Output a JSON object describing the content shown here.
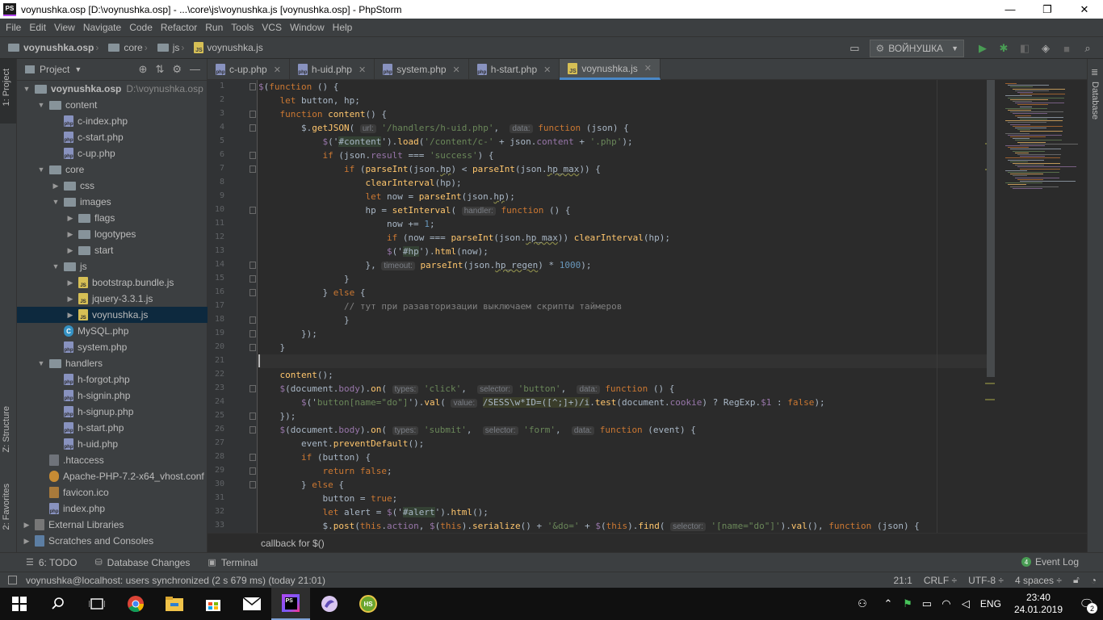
{
  "window": {
    "title": "voynushka.osp [D:\\voynushka.osp] - ...\\core\\js\\voynushka.js [voynushka.osp] - PhpStorm",
    "app_icon": "PS",
    "controls": {
      "minimize": "—",
      "maximize": "❐",
      "close": "✕"
    }
  },
  "menu": [
    "File",
    "Edit",
    "View",
    "Navigate",
    "Code",
    "Refactor",
    "Run",
    "Tools",
    "VCS",
    "Window",
    "Help"
  ],
  "navbar": {
    "crumbs": [
      "voynushka.osp",
      "core",
      "js",
      "voynushka.js"
    ],
    "run_config": "ВОЙНУШКА"
  },
  "left_strip": {
    "project": "1: Project",
    "structure": "Z: Structure",
    "favorites": "2: Favorites"
  },
  "right_strip": {
    "database": "Database"
  },
  "project_panel": {
    "title": "Project",
    "tree": [
      {
        "label": "voynushka.osp",
        "sub": "D:\\voynushka.osp",
        "depth": 0,
        "kind": "dir",
        "open": true,
        "bold": true
      },
      {
        "label": "content",
        "depth": 1,
        "kind": "dir",
        "open": true
      },
      {
        "label": "c-index.php",
        "depth": 2,
        "kind": "php"
      },
      {
        "label": "c-start.php",
        "depth": 2,
        "kind": "php"
      },
      {
        "label": "c-up.php",
        "depth": 2,
        "kind": "php"
      },
      {
        "label": "core",
        "depth": 1,
        "kind": "dir",
        "open": true
      },
      {
        "label": "css",
        "depth": 2,
        "kind": "dir",
        "open": false
      },
      {
        "label": "images",
        "depth": 2,
        "kind": "dir",
        "open": true
      },
      {
        "label": "flags",
        "depth": 3,
        "kind": "dir",
        "open": false
      },
      {
        "label": "logotypes",
        "depth": 3,
        "kind": "dir",
        "open": false
      },
      {
        "label": "start",
        "depth": 3,
        "kind": "dir",
        "open": false
      },
      {
        "label": "js",
        "depth": 2,
        "kind": "dir",
        "open": true
      },
      {
        "label": "bootstrap.bundle.js",
        "depth": 3,
        "kind": "js",
        "arrow": true
      },
      {
        "label": "jquery-3.3.1.js",
        "depth": 3,
        "kind": "js",
        "arrow": true
      },
      {
        "label": "voynushka.js",
        "depth": 3,
        "kind": "js",
        "arrow": true,
        "selected": true
      },
      {
        "label": "MySQL.php",
        "depth": 2,
        "kind": "sql"
      },
      {
        "label": "system.php",
        "depth": 2,
        "kind": "php"
      },
      {
        "label": "handlers",
        "depth": 1,
        "kind": "dir",
        "open": true
      },
      {
        "label": "h-forgot.php",
        "depth": 2,
        "kind": "php"
      },
      {
        "label": "h-signin.php",
        "depth": 2,
        "kind": "php"
      },
      {
        "label": "h-signup.php",
        "depth": 2,
        "kind": "php"
      },
      {
        "label": "h-start.php",
        "depth": 2,
        "kind": "php"
      },
      {
        "label": "h-uid.php",
        "depth": 2,
        "kind": "php"
      },
      {
        "label": ".htaccess",
        "depth": 1,
        "kind": "ht"
      },
      {
        "label": "Apache-PHP-7.2-x64_vhost.conf",
        "depth": 1,
        "kind": "conf"
      },
      {
        "label": "favicon.ico",
        "depth": 1,
        "kind": "ico"
      },
      {
        "label": "index.php",
        "depth": 1,
        "kind": "php"
      },
      {
        "label": "External Libraries",
        "depth": 0,
        "kind": "lib",
        "open": false
      },
      {
        "label": "Scratches and Consoles",
        "depth": 0,
        "kind": "scr",
        "open": false
      }
    ]
  },
  "tabs": [
    {
      "label": "c-up.php",
      "kind": "php",
      "active": false
    },
    {
      "label": "h-uid.php",
      "kind": "php",
      "active": false
    },
    {
      "label": "system.php",
      "kind": "php",
      "active": false
    },
    {
      "label": "h-start.php",
      "kind": "php",
      "active": false
    },
    {
      "label": "voynushka.js",
      "kind": "js",
      "active": true
    }
  ],
  "editor": {
    "line_numbers": [
      "1",
      "2",
      "3",
      "4",
      "5",
      "6",
      "7",
      "8",
      "9",
      "10",
      "11",
      "12",
      "13",
      "14",
      "15",
      "16",
      "17",
      "18",
      "19",
      "20",
      "21",
      "22",
      "23",
      "24",
      "25",
      "26",
      "27",
      "28",
      "29",
      "30",
      "31",
      "32",
      "33"
    ],
    "current_line": 21,
    "lines": [
      [
        [
          "$",
          "p"
        ],
        [
          "(",
          ""
        ],
        [
          "function",
          "k"
        ],
        [
          " () {",
          ""
        ]
      ],
      [
        [
          "    ",
          ""
        ],
        [
          "let",
          "k"
        ],
        [
          " button, hp;",
          ""
        ]
      ],
      [
        [
          "    ",
          ""
        ],
        [
          "function",
          "k"
        ],
        [
          " ",
          ""
        ],
        [
          "content",
          "f"
        ],
        [
          "() {",
          ""
        ]
      ],
      [
        [
          "        $.",
          ""
        ],
        [
          "getJSON",
          "f"
        ],
        [
          "( ",
          ""
        ],
        [
          "url:",
          "hint"
        ],
        [
          " ",
          ""
        ],
        [
          "'/handlers/h-uid.php'",
          "s"
        ],
        [
          ",  ",
          ""
        ],
        [
          "data:",
          "hint"
        ],
        [
          " ",
          ""
        ],
        [
          "function",
          "k"
        ],
        [
          " (json) {",
          ""
        ]
      ],
      [
        [
          "            ",
          ""
        ],
        [
          "$",
          "p"
        ],
        [
          "('",
          ""
        ],
        [
          "#content",
          "sel"
        ],
        [
          "').",
          ""
        ],
        [
          "load",
          "f"
        ],
        [
          "(",
          ""
        ],
        [
          "'/content/c-'",
          "s"
        ],
        [
          " + json.",
          ""
        ],
        [
          "content",
          "p"
        ],
        [
          " + ",
          ""
        ],
        [
          "'.php'",
          "s"
        ],
        [
          ");",
          ""
        ]
      ],
      [
        [
          "            ",
          ""
        ],
        [
          "if",
          "k"
        ],
        [
          " (json.",
          ""
        ],
        [
          "result",
          "p"
        ],
        [
          " === ",
          ""
        ],
        [
          "'success'",
          "s"
        ],
        [
          ") {",
          ""
        ]
      ],
      [
        [
          "                ",
          ""
        ],
        [
          "if",
          "k"
        ],
        [
          " (",
          ""
        ],
        [
          "parseInt",
          "f"
        ],
        [
          "(json.",
          ""
        ],
        [
          "hp",
          "ul"
        ],
        [
          ") < ",
          ""
        ],
        [
          "parseInt",
          "f"
        ],
        [
          "(json.",
          ""
        ],
        [
          "hp_max",
          "ul"
        ],
        [
          ")) {",
          ""
        ]
      ],
      [
        [
          "                    ",
          ""
        ],
        [
          "clearInterval",
          "f"
        ],
        [
          "(hp);",
          ""
        ]
      ],
      [
        [
          "                    ",
          ""
        ],
        [
          "let",
          "k"
        ],
        [
          " now = ",
          ""
        ],
        [
          "parseInt",
          "f"
        ],
        [
          "(json.",
          ""
        ],
        [
          "hp",
          "ul"
        ],
        [
          ");",
          ""
        ]
      ],
      [
        [
          "                    hp = ",
          ""
        ],
        [
          "setInterval",
          "f"
        ],
        [
          "( ",
          ""
        ],
        [
          "handler:",
          "hint"
        ],
        [
          " ",
          ""
        ],
        [
          "function",
          "k"
        ],
        [
          " () {",
          ""
        ]
      ],
      [
        [
          "                        now += ",
          ""
        ],
        [
          "1",
          "n"
        ],
        [
          ";",
          ""
        ]
      ],
      [
        [
          "                        ",
          ""
        ],
        [
          "if",
          "k"
        ],
        [
          " (now === ",
          ""
        ],
        [
          "parseInt",
          "f"
        ],
        [
          "(json.",
          ""
        ],
        [
          "hp_max",
          "ul"
        ],
        [
          ")) ",
          ""
        ],
        [
          "clearInterval",
          "f"
        ],
        [
          "(hp);",
          ""
        ]
      ],
      [
        [
          "                        ",
          ""
        ],
        [
          "$",
          "p"
        ],
        [
          "('",
          ""
        ],
        [
          "#hp",
          "sel"
        ],
        [
          "').",
          ""
        ],
        [
          "html",
          "f"
        ],
        [
          "(now);",
          ""
        ]
      ],
      [
        [
          "                    }, ",
          ""
        ],
        [
          "timeout:",
          "hint"
        ],
        [
          " ",
          ""
        ],
        [
          "parseInt",
          "f"
        ],
        [
          "(json.",
          ""
        ],
        [
          "hp_regen",
          "ul"
        ],
        [
          ") * ",
          ""
        ],
        [
          "1000",
          "n"
        ],
        [
          ");",
          ""
        ]
      ],
      [
        [
          "                }",
          ""
        ]
      ],
      [
        [
          "            } ",
          ""
        ],
        [
          "else",
          "k"
        ],
        [
          " {",
          ""
        ]
      ],
      [
        [
          "                ",
          ""
        ],
        [
          "// тут при разавторизации выключаем скрипты таймеров",
          "c"
        ]
      ],
      [
        [
          "                }",
          ""
        ]
      ],
      [
        [
          "        });",
          ""
        ]
      ],
      [
        [
          "    }",
          ""
        ]
      ],
      [
        [
          "",
          ""
        ]
      ],
      [
        [
          "    ",
          ""
        ],
        [
          "content",
          "f"
        ],
        [
          "();",
          ""
        ]
      ],
      [
        [
          "    ",
          ""
        ],
        [
          "$",
          "p"
        ],
        [
          "(document.",
          ""
        ],
        [
          "body",
          "p"
        ],
        [
          ").",
          ""
        ],
        [
          "on",
          "f"
        ],
        [
          "( ",
          ""
        ],
        [
          "types:",
          "hint"
        ],
        [
          " ",
          ""
        ],
        [
          "'click'",
          "s"
        ],
        [
          ",  ",
          ""
        ],
        [
          "selector:",
          "hint"
        ],
        [
          " ",
          ""
        ],
        [
          "'button'",
          "s"
        ],
        [
          ",  ",
          ""
        ],
        [
          "data:",
          "hint"
        ],
        [
          " ",
          ""
        ],
        [
          "function",
          "k"
        ],
        [
          " () {",
          ""
        ]
      ],
      [
        [
          "        ",
          ""
        ],
        [
          "$",
          "p"
        ],
        [
          "('",
          ""
        ],
        [
          "button[name=\"do\"]",
          "s"
        ],
        [
          "').",
          ""
        ],
        [
          "val",
          "f"
        ],
        [
          "( ",
          ""
        ],
        [
          "value:",
          "hint"
        ],
        [
          " ",
          ""
        ],
        [
          "/SESS\\w*ID=([^;]+)/i",
          "rx"
        ],
        [
          ".",
          ""
        ],
        [
          "test",
          "f"
        ],
        [
          "(document.",
          ""
        ],
        [
          "cookie",
          "p"
        ],
        [
          ") ? RegExp.",
          ""
        ],
        [
          "$1",
          "p"
        ],
        [
          " : ",
          ""
        ],
        [
          "false",
          "k"
        ],
        [
          ");",
          ""
        ]
      ],
      [
        [
          "    });",
          ""
        ]
      ],
      [
        [
          "    ",
          ""
        ],
        [
          "$",
          "p"
        ],
        [
          "(document.",
          ""
        ],
        [
          "body",
          "p"
        ],
        [
          ").",
          ""
        ],
        [
          "on",
          "f"
        ],
        [
          "( ",
          ""
        ],
        [
          "types:",
          "hint"
        ],
        [
          " ",
          ""
        ],
        [
          "'submit'",
          "s"
        ],
        [
          ",  ",
          ""
        ],
        [
          "selector:",
          "hint"
        ],
        [
          " ",
          ""
        ],
        [
          "'form'",
          "s"
        ],
        [
          ",  ",
          ""
        ],
        [
          "data:",
          "hint"
        ],
        [
          " ",
          ""
        ],
        [
          "function",
          "k"
        ],
        [
          " (event) {",
          ""
        ]
      ],
      [
        [
          "        event.",
          ""
        ],
        [
          "preventDefault",
          "f"
        ],
        [
          "();",
          ""
        ]
      ],
      [
        [
          "        ",
          ""
        ],
        [
          "if",
          "k"
        ],
        [
          " (button) {",
          ""
        ]
      ],
      [
        [
          "            ",
          ""
        ],
        [
          "return false",
          "k"
        ],
        [
          ";",
          ""
        ]
      ],
      [
        [
          "        } ",
          ""
        ],
        [
          "else",
          "k"
        ],
        [
          " {",
          ""
        ]
      ],
      [
        [
          "            button = ",
          ""
        ],
        [
          "true",
          "k"
        ],
        [
          ";",
          ""
        ]
      ],
      [
        [
          "            ",
          ""
        ],
        [
          "let",
          "k"
        ],
        [
          " alert = ",
          ""
        ],
        [
          "$",
          "p"
        ],
        [
          "('",
          ""
        ],
        [
          "#alert",
          "sel"
        ],
        [
          "').",
          ""
        ],
        [
          "html",
          "f"
        ],
        [
          "();",
          ""
        ]
      ],
      [
        [
          "            $.",
          ""
        ],
        [
          "post",
          "f"
        ],
        [
          "(",
          ""
        ],
        [
          "this",
          "k"
        ],
        [
          ".",
          ""
        ],
        [
          "action",
          "p"
        ],
        [
          ", ",
          ""
        ],
        [
          "$",
          "p"
        ],
        [
          "(",
          ""
        ],
        [
          "this",
          "k"
        ],
        [
          ").",
          ""
        ],
        [
          "serialize",
          "f"
        ],
        [
          "() + ",
          ""
        ],
        [
          "'&do='",
          "s"
        ],
        [
          " + ",
          ""
        ],
        [
          "$",
          "p"
        ],
        [
          "(",
          ""
        ],
        [
          "this",
          "k"
        ],
        [
          ").",
          ""
        ],
        [
          "find",
          "f"
        ],
        [
          "( ",
          ""
        ],
        [
          "selector:",
          "hint"
        ],
        [
          " ",
          ""
        ],
        [
          "'[name=\"do\"]'",
          "s"
        ],
        [
          ").",
          ""
        ],
        [
          "val",
          "f"
        ],
        [
          "(), ",
          ""
        ],
        [
          "function",
          "k"
        ],
        [
          " (json) {",
          ""
        ]
      ]
    ]
  },
  "code_breadcrumb": "callback for $()",
  "tool_windows": {
    "todo": "6: TODO",
    "db_changes": "Database Changes",
    "terminal": "Terminal",
    "event_log": "Event Log",
    "event_count": "4"
  },
  "status": {
    "message": "voynushka@localhost: users synchronized (2 s 679 ms) (today 21:01)",
    "position": "21:1",
    "line_sep": "CRLF ÷",
    "encoding": "UTF-8 ÷",
    "indent": "4 spaces ÷"
  },
  "taskbar": {
    "lang": "ENG",
    "time": "23:40",
    "date": "24.01.2019",
    "notif_count": "2"
  },
  "colors": {
    "accent": "#4a88c7",
    "selected_row": "#0d293e",
    "php_icon": "#8892bf",
    "js_icon": "#d6bf55"
  }
}
